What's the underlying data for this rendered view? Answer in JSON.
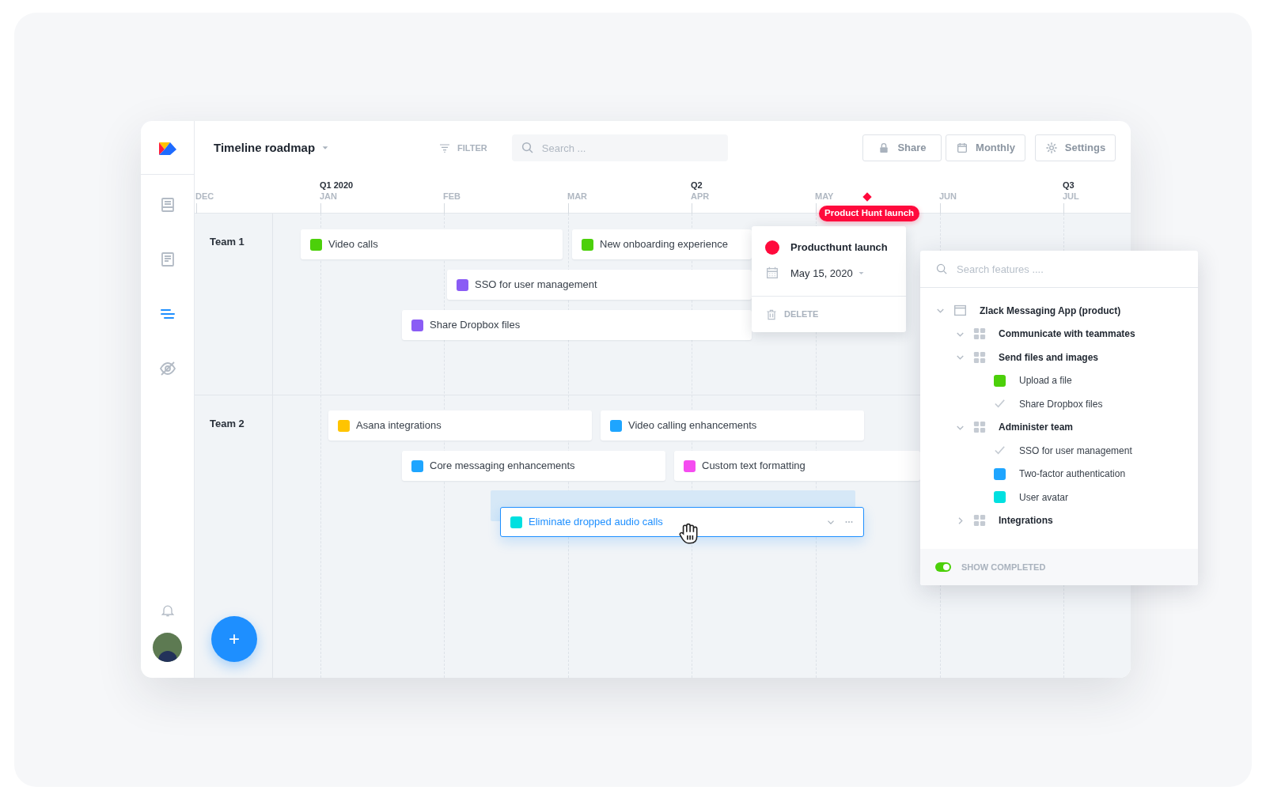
{
  "header": {
    "title": "Timeline roadmap",
    "filter": "FILTER",
    "search": {
      "placeholder": "Search ..."
    },
    "buttons": [
      {
        "label": "Share",
        "kind": "lock"
      },
      {
        "label": "Monthly",
        "kind": "calendar"
      },
      {
        "label": "Settings",
        "kind": "gear"
      }
    ]
  },
  "sidebar": {
    "items": [
      {
        "kind": "inbox",
        "selected": false
      },
      {
        "kind": "note",
        "selected": false
      },
      {
        "kind": "timeline",
        "selected": true
      },
      {
        "kind": "hidden",
        "selected": false
      }
    ]
  },
  "timeline": {
    "months": [
      {
        "label": "DEC"
      },
      {
        "quarter": "Q1 2020",
        "label": "JAN"
      },
      {
        "label": "FEB"
      },
      {
        "label": "MAR"
      },
      {
        "quarter": "Q2",
        "label": "APR"
      },
      {
        "label": "MAY"
      },
      {
        "label": "JUN"
      },
      {
        "quarter": "Q3",
        "label": "JUL"
      }
    ],
    "marker": {
      "label": "Product Hunt launch",
      "color": "#ff0a3c"
    },
    "teams": [
      {
        "name": "Team 1",
        "bars": [
          {
            "label": "Video calls",
            "color": "#4cd00a",
            "selected": false
          },
          {
            "label": "New onboarding experience",
            "color": "#4cd00a",
            "selected": false
          },
          {
            "label": "SSO for user management",
            "color": "#8a5cf5",
            "selected": false
          },
          {
            "label": "Share Dropbox files",
            "color": "#8a5cf5",
            "selected": false
          }
        ]
      },
      {
        "name": "Team 2",
        "bars": [
          {
            "label": "Asana integrations",
            "color": "#ffc400",
            "selected": false
          },
          {
            "label": "Video calling enhancements",
            "color": "#1ea5ff",
            "selected": false
          },
          {
            "label": "Core messaging enhancements",
            "color": "#1ea5ff",
            "selected": false
          },
          {
            "label": "Custom text formatting",
            "color": "#f54cf0",
            "selected": false
          },
          {
            "label": "Eliminate dropped audio calls",
            "color": "#00e0e0",
            "selected": true
          }
        ]
      }
    ]
  },
  "milestone_popover": {
    "title": "Producthunt launch",
    "color": "#ff0a3c",
    "date": "May 15, 2020",
    "delete": "DELETE"
  },
  "feature_panel": {
    "search": {
      "placeholder": "Search features ...."
    },
    "tree": [
      {
        "label": "Zlack Messaging App (product)",
        "kind": "product",
        "expanded": true,
        "children": [
          {
            "label": "Communicate with teammates",
            "kind": "group",
            "expanded": true
          },
          {
            "label": "Send files and images",
            "kind": "group",
            "expanded": true,
            "children": [
              {
                "label": "Upload a file",
                "kind": "feature",
                "color": "#4cd00a"
              },
              {
                "label": "Share Dropbox files",
                "kind": "done"
              }
            ]
          },
          {
            "label": "Administer team",
            "kind": "group",
            "expanded": true,
            "children": [
              {
                "label": "SSO for user management",
                "kind": "done"
              },
              {
                "label": "Two-factor authentication",
                "kind": "feature",
                "color": "#1ea5ff"
              },
              {
                "label": "User avatar",
                "kind": "feature",
                "color": "#00e0e0"
              }
            ]
          },
          {
            "label": "Integrations",
            "kind": "group",
            "expanded": false
          }
        ]
      }
    ],
    "show_completed": {
      "label": "SHOW COMPLETED",
      "on": true
    }
  },
  "fab": {
    "label": "+"
  }
}
